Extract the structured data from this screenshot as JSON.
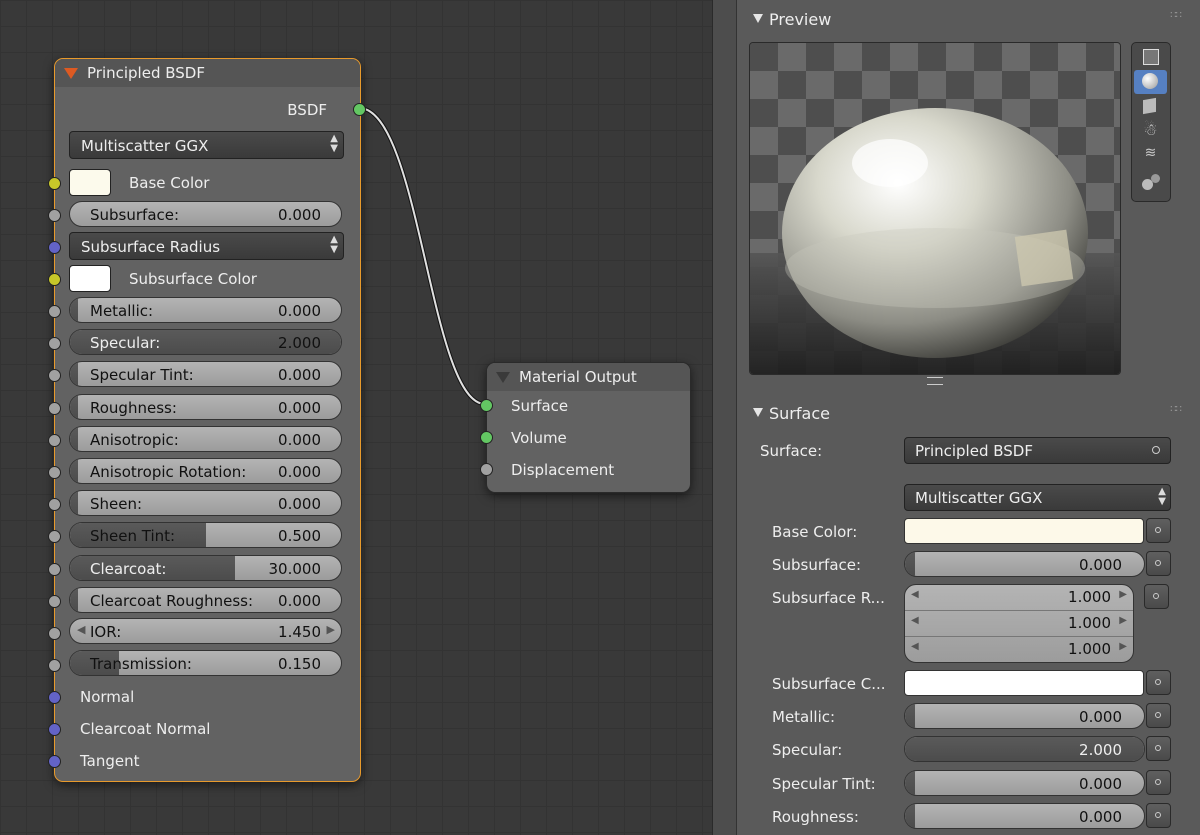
{
  "node_editor": {
    "bsdf_node": {
      "title": "Principled BSDF",
      "output_label": "BSDF",
      "distribution": "Multiscatter GGX",
      "base_color_label": "Base Color",
      "base_color": "#fcfaec",
      "subsurface": {
        "label": "Subsurface:",
        "value": "0.000"
      },
      "subsurface_radius": "Subsurface Radius",
      "subsurface_color_label": "Subsurface Color",
      "subsurface_color": "#ffffff",
      "params": [
        {
          "label": "Metallic:",
          "value": "0.000",
          "fill": 0
        },
        {
          "label": "Specular:",
          "value": "2.000",
          "fill": 1
        },
        {
          "label": "Specular Tint:",
          "value": "0.000",
          "fill": 0
        },
        {
          "label": "Roughness:",
          "value": "0.000",
          "fill": 0
        },
        {
          "label": "Anisotropic:",
          "value": "0.000",
          "fill": 0
        },
        {
          "label": "Anisotropic Rotation:",
          "value": "0.000",
          "fill": 0
        },
        {
          "label": "Sheen:",
          "value": "0.000",
          "fill": 0
        },
        {
          "label": "Sheen Tint:",
          "value": "0.500",
          "fill": 0.5
        },
        {
          "label": "Clearcoat:",
          "value": "30.000",
          "fill": 1
        },
        {
          "label": "Clearcoat Roughness:",
          "value": "0.000",
          "fill": 0
        }
      ],
      "ior": {
        "label": "IOR:",
        "value": "1.450"
      },
      "transmission": {
        "label": "Transmission:",
        "value": "0.150",
        "fill": 0.15
      },
      "inputs": [
        "Normal",
        "Clearcoat Normal",
        "Tangent"
      ]
    },
    "output_node": {
      "title": "Material Output",
      "sockets": [
        "Surface",
        "Volume",
        "Displacement"
      ]
    }
  },
  "properties": {
    "preview_title": "Preview",
    "surface_title": "Surface",
    "surface_label": "Surface:",
    "surface_value": "Principled BSDF",
    "distribution": "Multiscatter GGX",
    "base_color_label": "Base Color:",
    "base_color": "#fdf9e9",
    "subsurface": {
      "label": "Subsurface:",
      "value": "0.000"
    },
    "subsurface_radius": {
      "label": "Subsurface R...",
      "values": [
        "1.000",
        "1.000",
        "1.000"
      ]
    },
    "subsurface_color_label": "Subsurface C...",
    "subsurface_color": "#ffffff",
    "fields": [
      {
        "label": "Metallic:",
        "value": "0.000",
        "fill": 0
      },
      {
        "label": "Specular:",
        "value": "2.000",
        "fill": 1
      },
      {
        "label": "Specular Tint:",
        "value": "0.000",
        "fill": 0
      },
      {
        "label": "Roughness:",
        "value": "0.000",
        "fill": 0
      }
    ]
  },
  "colors": {
    "selected_outline": "#e89a2c",
    "active_tool": "#5680c2"
  },
  "icons": [
    "collapse-triangle-icon",
    "plane-preview-icon",
    "sphere-preview-icon",
    "cube-preview-icon",
    "monkey-preview-icon",
    "hair-preview-icon",
    "sphere-cluster-preview-icon",
    "panel-grip-icon",
    "up-down-arrows-icon",
    "socket-link-icon"
  ]
}
